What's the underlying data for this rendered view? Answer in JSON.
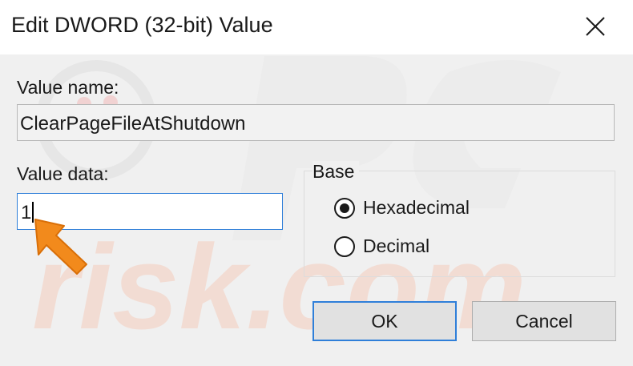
{
  "dialog": {
    "title": "Edit DWORD (32-bit) Value",
    "close_icon": "close-x-icon"
  },
  "value_name": {
    "label": "Value name:",
    "value": "ClearPageFileAtShutdown"
  },
  "value_data": {
    "label": "Value data:",
    "value": "1"
  },
  "base": {
    "legend": "Base",
    "options": [
      {
        "label": "Hexadecimal",
        "checked": true
      },
      {
        "label": "Decimal",
        "checked": false
      }
    ]
  },
  "buttons": {
    "ok_label": "OK",
    "cancel_label": "Cancel"
  },
  "annotation": {
    "pointer_icon": "orange-arrow-icon",
    "pointer_color": "#f28a1c"
  },
  "watermark": {
    "text": "risk.com",
    "color": "#f5c9b8"
  }
}
